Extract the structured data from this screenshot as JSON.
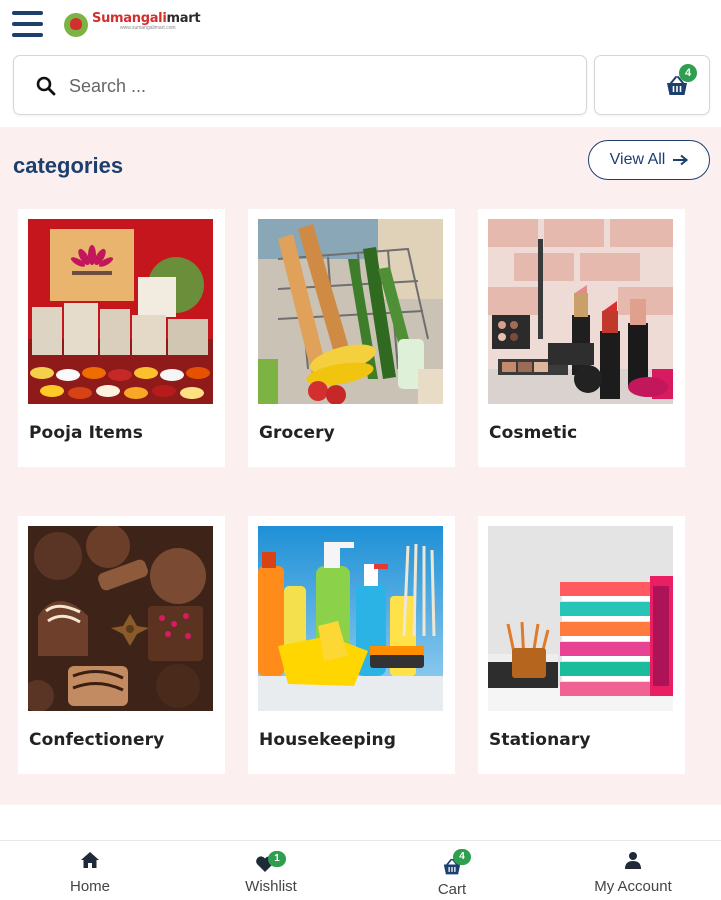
{
  "header": {
    "brand_part1": "Sumangali",
    "brand_part2": "mart",
    "brand_tagline": "www.sumangalimart.com"
  },
  "search": {
    "placeholder": "Search ..."
  },
  "cart": {
    "count": "4"
  },
  "categories": {
    "title": "categories",
    "view_all_label": "View All",
    "items": [
      {
        "label": "Pooja Items"
      },
      {
        "label": "Grocery"
      },
      {
        "label": "Cosmetic"
      },
      {
        "label": "Confectionery"
      },
      {
        "label": "Housekeeping"
      },
      {
        "label": "Stationary"
      }
    ]
  },
  "bottom_nav": {
    "items": [
      {
        "label": "Home",
        "icon": "home-icon"
      },
      {
        "label": "Wishlist",
        "icon": "heart-icon",
        "badge": "1"
      },
      {
        "label": "Cart",
        "icon": "basket-icon",
        "badge": "4"
      },
      {
        "label": "My Account",
        "icon": "user-icon"
      }
    ]
  },
  "colors": {
    "primary": "#1d3f6e",
    "badge": "#2e9e4f",
    "section_background": "#fcefef",
    "brand_red": "#d32f2f"
  }
}
